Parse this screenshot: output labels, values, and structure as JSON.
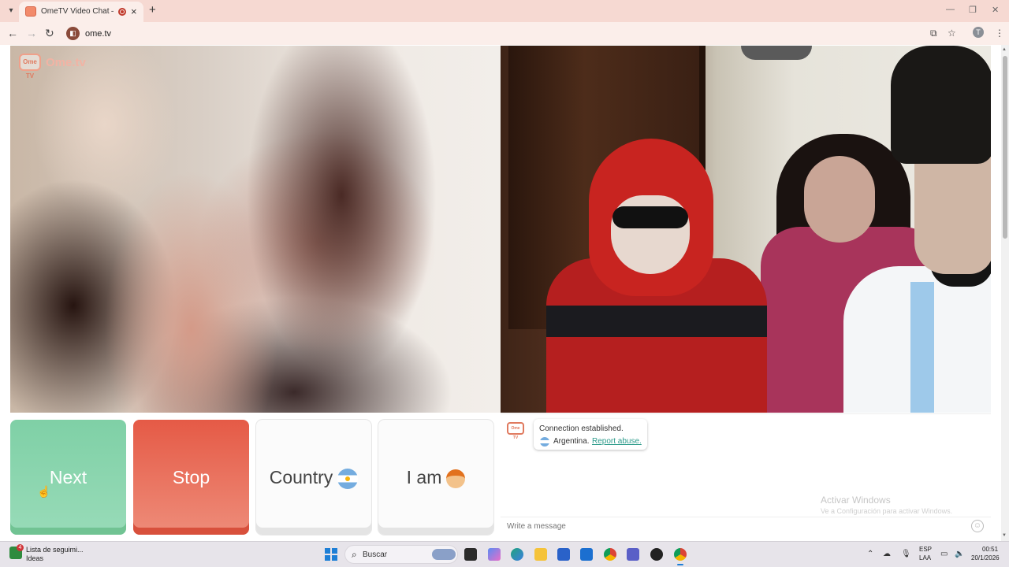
{
  "browser": {
    "tab_title": "OmeTV Video Chat — Ome",
    "url": "ome.tv",
    "profile_initial": "T",
    "icons": [
      "tab-list-icon",
      "close-icon",
      "new-tab-icon",
      "minimize-icon",
      "maximize-icon",
      "close-window-icon",
      "back-icon",
      "forward-icon",
      "reload-icon",
      "install-app-icon",
      "bookmark-star-icon",
      "kebab-menu-icon"
    ]
  },
  "site": {
    "logo_text": "Ome.tv",
    "logo_badge": "Ome TV"
  },
  "controls": {
    "next_label": "Next",
    "stop_label": "Stop",
    "country_label": "Country",
    "iam_label": "I am"
  },
  "chat": {
    "status": "Connection established.",
    "country": "Argentina.",
    "report_link": "Report abuse.",
    "input_placeholder": "Write a message"
  },
  "watermark": {
    "line1": "Activar Windows",
    "line2": "Ve a Configuración para activar Windows."
  },
  "taskbar": {
    "news_line1": "Lista de seguimi...",
    "news_line2": "Ideas",
    "widget_badge": "4",
    "search_placeholder": "Buscar",
    "lang_line1": "ESP",
    "lang_line2": "LAA",
    "time": "00:51",
    "date": "20/1/2026"
  },
  "colors": {
    "next": "#7fd0a6",
    "stop": "#e55a46",
    "accent": "#e07a5f",
    "link": "#2b9a8a"
  }
}
